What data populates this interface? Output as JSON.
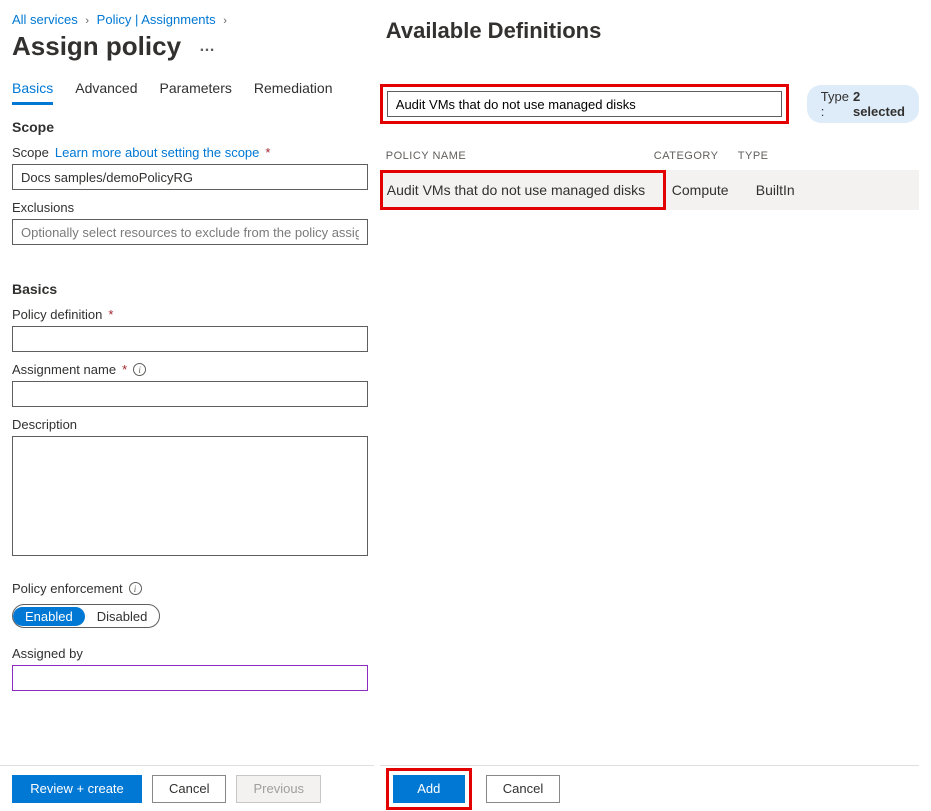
{
  "breadcrumb": {
    "item1": "All services",
    "item2": "Policy | Assignments"
  },
  "page_title": "Assign policy",
  "tabs": {
    "basics": "Basics",
    "advanced": "Advanced",
    "parameters": "Parameters",
    "remediation": "Remediation"
  },
  "scope": {
    "header": "Scope",
    "label": "Scope",
    "learn_more": "Learn more about setting the scope",
    "value": "Docs samples/demoPolicyRG",
    "exclusions_label": "Exclusions",
    "exclusions_placeholder": "Optionally select resources to exclude from the policy assignment"
  },
  "basics": {
    "header": "Basics",
    "policy_def_label": "Policy definition",
    "assignment_name_label": "Assignment name",
    "description_label": "Description",
    "enforcement_label": "Policy enforcement",
    "toggle_enabled": "Enabled",
    "toggle_disabled": "Disabled",
    "assigned_by_label": "Assigned by"
  },
  "footer": {
    "review_create": "Review + create",
    "cancel": "Cancel",
    "previous": "Previous"
  },
  "panel": {
    "title": "Available Definitions",
    "search_value": "Audit VMs that do not use managed disks",
    "type_label": "Type : ",
    "type_count": "2 selected",
    "columns": {
      "name": "Policy name",
      "category": "Category",
      "type": "Type"
    },
    "row": {
      "name": "Audit VMs that do not use managed disks",
      "category": "Compute",
      "type": "BuiltIn"
    },
    "add": "Add",
    "cancel": "Cancel"
  }
}
